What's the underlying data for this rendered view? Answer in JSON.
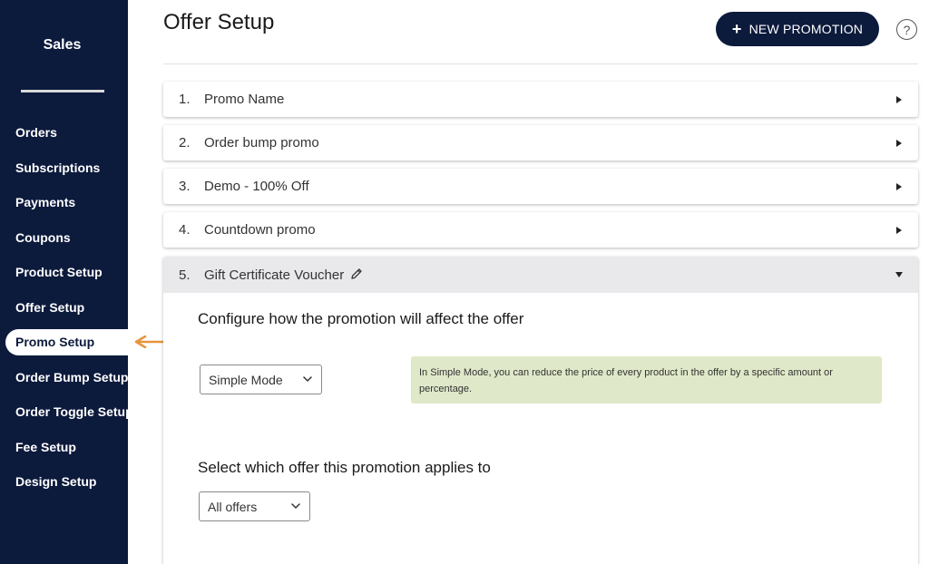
{
  "sidebar": {
    "brand": "Sales",
    "items": [
      {
        "label": "Orders"
      },
      {
        "label": "Subscriptions"
      },
      {
        "label": "Payments"
      },
      {
        "label": "Coupons"
      },
      {
        "label": "Product Setup"
      },
      {
        "label": "Offer Setup"
      },
      {
        "label": "Promo Setup",
        "active": true
      },
      {
        "label": "Order Bump Setup"
      },
      {
        "label": "Order Toggle Setup"
      },
      {
        "label": "Fee Setup"
      },
      {
        "label": "Design Setup"
      }
    ]
  },
  "header": {
    "title": "Offer Setup",
    "new_button_label": "NEW PROMOTION",
    "help_label": "?"
  },
  "promos": [
    {
      "number": "1.",
      "name": "Promo Name"
    },
    {
      "number": "2.",
      "name": "Order bump promo"
    },
    {
      "number": "3.",
      "name": "Demo - 100% Off"
    },
    {
      "number": "4.",
      "name": "Countdown promo"
    }
  ],
  "expanded": {
    "number": "5.",
    "name": "Gift Certificate Voucher",
    "configure_heading": "Configure how the promotion will affect the offer",
    "mode_select": "Simple Mode",
    "info_prefix": "In ",
    "info_bold": "Simple Mode",
    "info_rest": ", you can reduce the price of every product in the offer by a specific amount or percentage.",
    "offer_heading": "Select which offer this promotion applies to",
    "offer_select": "All offers"
  },
  "colors": {
    "sidebar_bg": "#0c1a3c",
    "accent_arrow": "#e8943a",
    "info_bg": "#dfe8c8"
  }
}
